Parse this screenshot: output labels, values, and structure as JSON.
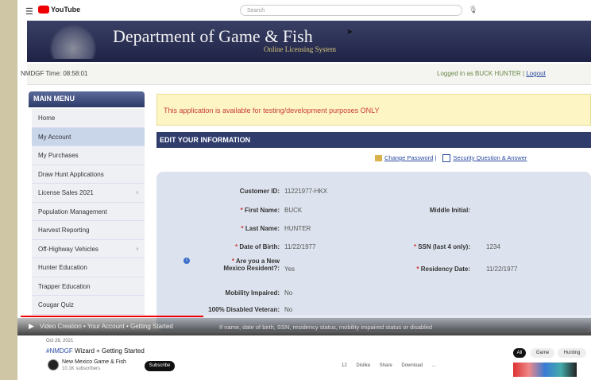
{
  "youtube": {
    "menu_icon": "hamburger-icon",
    "logo_text": "YouTube",
    "search_placeholder": "Search",
    "mic_icon": "mic-icon"
  },
  "banner": {
    "title": "Department of Game & Fish",
    "subtitle": "Online Licensing System"
  },
  "status": {
    "time": "NMDGF Time: 08:58:01",
    "logged_in": "Logged in as BUCK HUNTER |",
    "logout": "Logout"
  },
  "sidebar": {
    "header": "MAIN MENU",
    "items": [
      {
        "label": "Home",
        "arrow": ""
      },
      {
        "label": "My Account",
        "arrow": ""
      },
      {
        "label": "My Purchases",
        "arrow": ""
      },
      {
        "label": "Draw Hunt Applications",
        "arrow": ""
      },
      {
        "label": "License Sales 2021",
        "arrow": "›"
      },
      {
        "label": "Population Management",
        "arrow": ""
      },
      {
        "label": "Harvest Reporting",
        "arrow": ""
      },
      {
        "label": "Off-Highway Vehicles",
        "arrow": "›"
      },
      {
        "label": "Hunter Education",
        "arrow": ""
      },
      {
        "label": "Trapper Education",
        "arrow": ""
      },
      {
        "label": "Cougar Quiz",
        "arrow": ""
      }
    ]
  },
  "notice": "This application is available for testing/development purposes ONLY",
  "section_title": "EDIT YOUR INFORMATION",
  "links": {
    "change_password": "Change Password",
    "security_question": "Security Question & Answer"
  },
  "form": {
    "customer_id_label": "Customer ID:",
    "customer_id": "11221977-HKX",
    "first_name_label": "First Name:",
    "first_name": "BUCK",
    "middle_initial_label": "Middle Initial:",
    "last_name_label": "Last Name:",
    "last_name": "HUNTER",
    "dob_label": "Date of Birth:",
    "dob": "11/22/1977",
    "ssn_label": "SSN (last 4 only):",
    "ssn": "1234",
    "resident_label_1": "Are you a New",
    "resident_label_2": "Mexico Resident?:",
    "resident": "Yes",
    "residency_date_label": "Residency Date:",
    "residency_date": "11/22/1977",
    "mobility_label": "Mobility Impaired:",
    "mobility": "No",
    "disabled_label": "100% Disabled Veteran:",
    "disabled": "No"
  },
  "video": {
    "chapter": "Video Creation • Your Account • Getting Started",
    "caption": "If name, date of birth, SSN, residency status, mobility impaired status or disabled",
    "progress": 0.32
  },
  "below_video": {
    "date": "Oct 28, 2021",
    "title_tag": "#NMDGF",
    "title": "Wizard + Getting Started",
    "channel": "New Mexico Game & Fish",
    "subs": "10.1K subscribers",
    "subscribe": "Subscribe",
    "actions": [
      "12",
      "Dislike",
      "Share",
      "Download",
      "..."
    ],
    "side_buttons": [
      "All",
      "Game",
      "Hunting"
    ]
  }
}
